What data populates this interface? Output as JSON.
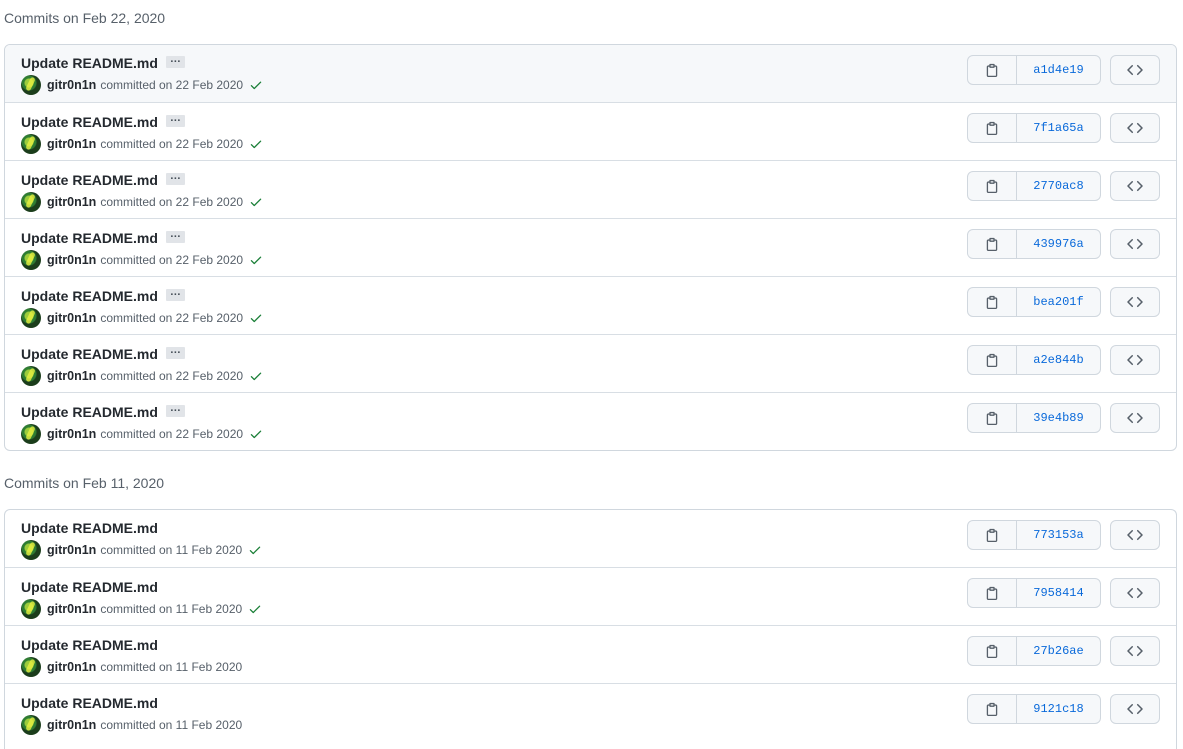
{
  "groups": [
    {
      "title": "Commits on Feb 22, 2020",
      "commits": [
        {
          "message": "Update README.md",
          "author": "gitr0n1n",
          "committed": "committed on 22 Feb 2020",
          "sha": "a1d4e19",
          "verified": true,
          "has_ellipsis": true
        },
        {
          "message": "Update README.md",
          "author": "gitr0n1n",
          "committed": "committed on 22 Feb 2020",
          "sha": "7f1a65a",
          "verified": true,
          "has_ellipsis": true
        },
        {
          "message": "Update README.md",
          "author": "gitr0n1n",
          "committed": "committed on 22 Feb 2020",
          "sha": "2770ac8",
          "verified": true,
          "has_ellipsis": true
        },
        {
          "message": "Update README.md",
          "author": "gitr0n1n",
          "committed": "committed on 22 Feb 2020",
          "sha": "439976a",
          "verified": true,
          "has_ellipsis": true
        },
        {
          "message": "Update README.md",
          "author": "gitr0n1n",
          "committed": "committed on 22 Feb 2020",
          "sha": "bea201f",
          "verified": true,
          "has_ellipsis": true
        },
        {
          "message": "Update README.md",
          "author": "gitr0n1n",
          "committed": "committed on 22 Feb 2020",
          "sha": "a2e844b",
          "verified": true,
          "has_ellipsis": true
        },
        {
          "message": "Update README.md",
          "author": "gitr0n1n",
          "committed": "committed on 22 Feb 2020",
          "sha": "39e4b89",
          "verified": true,
          "has_ellipsis": true
        }
      ]
    },
    {
      "title": "Commits on Feb 11, 2020",
      "commits": [
        {
          "message": "Update README.md",
          "author": "gitr0n1n",
          "committed": "committed on 11 Feb 2020",
          "sha": "773153a",
          "verified": true,
          "has_ellipsis": false
        },
        {
          "message": "Update README.md",
          "author": "gitr0n1n",
          "committed": "committed on 11 Feb 2020",
          "sha": "7958414",
          "verified": true,
          "has_ellipsis": false
        },
        {
          "message": "Update README.md",
          "author": "gitr0n1n",
          "committed": "committed on 11 Feb 2020",
          "sha": "27b26ae",
          "verified": false,
          "has_ellipsis": false
        },
        {
          "message": "Update README.md",
          "author": "gitr0n1n",
          "committed": "committed on 11 Feb 2020",
          "sha": "9121c18",
          "verified": false,
          "has_ellipsis": false
        }
      ]
    }
  ],
  "icons": {
    "ellipsis": "…",
    "copy": "clipboard-icon",
    "browse": "code-icon",
    "check": "check-icon"
  },
  "colors": {
    "sha_link": "#0969da",
    "check": "#1a7f37",
    "row_hover": "#f6f8fa",
    "border": "#d0d7de"
  }
}
